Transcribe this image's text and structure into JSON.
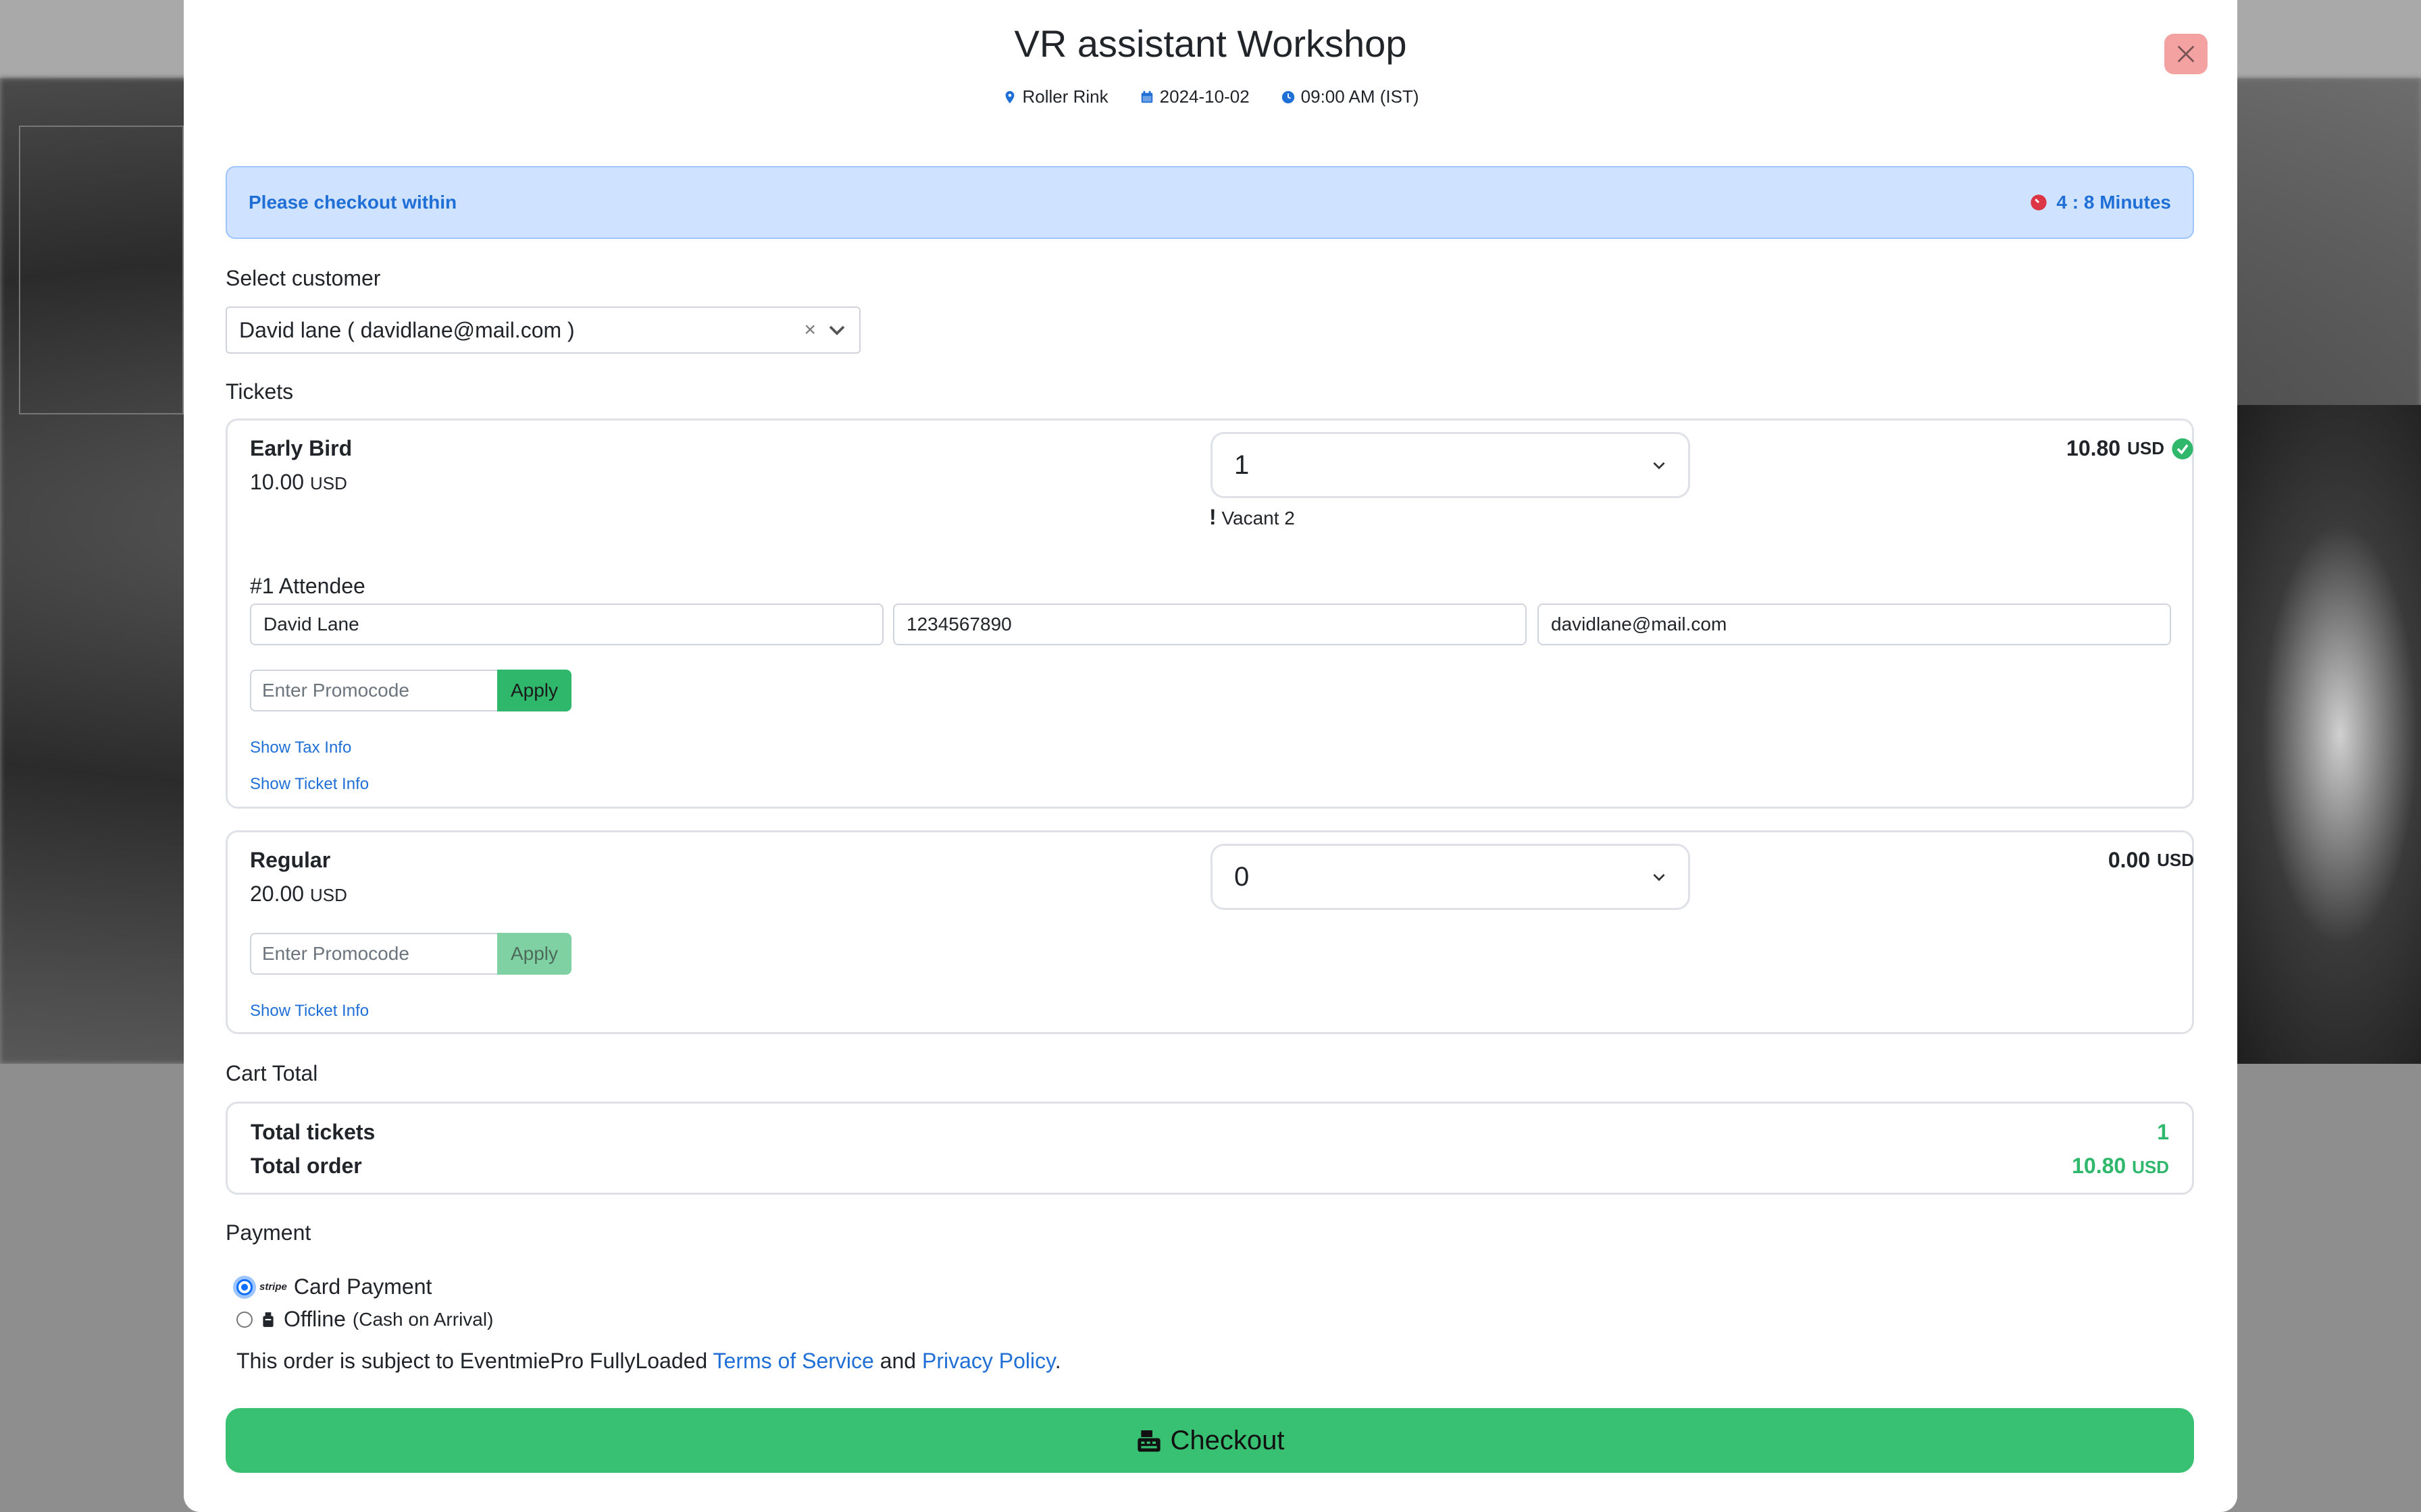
{
  "event": {
    "title": "VR assistant Workshop",
    "venue": "Roller Rink",
    "date": "2024-10-02",
    "time": "09:00 AM (IST)"
  },
  "alert": {
    "message": "Please checkout within",
    "timer": "4 : 8 Minutes"
  },
  "customer": {
    "label": "Select customer",
    "selected": "David lane ( davidlane@mail.com )",
    "clear_symbol": "×"
  },
  "tickets": {
    "label": "Tickets",
    "items": [
      {
        "name": "Early Bird",
        "price": "10.00",
        "currency": "USD",
        "quantity": "1",
        "vacant_mark": "!",
        "vacant": "Vacant 2",
        "total": "10.80",
        "attendee_label": "#1 Attendee",
        "attendee_name": "David Lane",
        "attendee_phone": "1234567890",
        "attendee_email": "davidlane@mail.com",
        "promo_placeholder": "Enter Promocode",
        "apply_label": "Apply",
        "tax_link": "Show Tax Info",
        "info_link": "Show Ticket Info"
      },
      {
        "name": "Regular",
        "price": "20.00",
        "currency": "USD",
        "quantity": "0",
        "total": "0.00",
        "promo_placeholder": "Enter Promocode",
        "apply_label": "Apply",
        "info_link": "Show Ticket Info"
      }
    ]
  },
  "cart": {
    "label": "Cart Total",
    "tickets_label": "Total tickets",
    "tickets_value": "1",
    "order_label": "Total order",
    "order_value": "10.80",
    "currency": "USD"
  },
  "payment": {
    "label": "Payment",
    "card_brand": "stripe",
    "card_label": "Card Payment",
    "offline_label": "Offline",
    "offline_note": "(Cash on Arrival)"
  },
  "terms": {
    "prefix": "This order is subject to EventmiePro FullyLoaded ",
    "tos": "Terms of Service",
    "and": " and ",
    "privacy": "Privacy Policy",
    "suffix": "."
  },
  "checkout_label": "Checkout",
  "colors": {
    "primary": "#1f6fd6",
    "success": "#38c172",
    "alert_bg": "#cfe2ff",
    "danger": "#dc3545",
    "close_bg": "#f3a1a1"
  }
}
